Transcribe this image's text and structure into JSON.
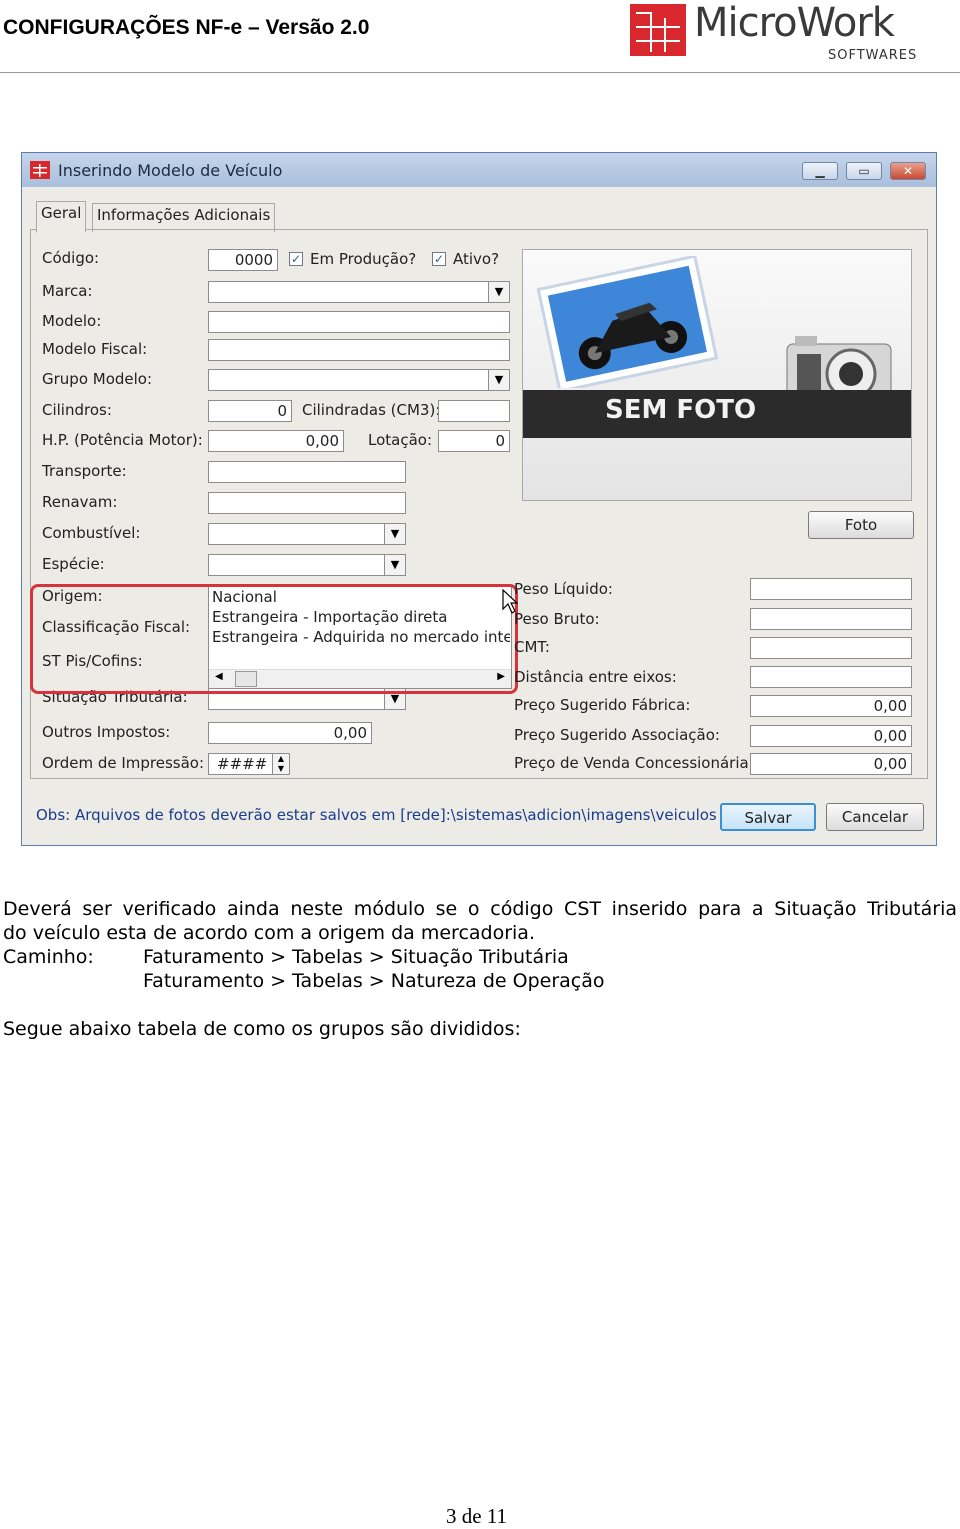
{
  "header": {
    "title": "CONFIGURAÇÕES NF-e – Versão 2.0",
    "logo_name": "MicroWork",
    "logo_sub": "SOFTWARES"
  },
  "window": {
    "title": "Inserindo Modelo de Veículo",
    "controls": {
      "minimize": "minimize-icon",
      "maximize": "maximize-icon",
      "close": "close-icon"
    },
    "tabs": [
      "Geral",
      "Informações Adicionais"
    ],
    "fields": {
      "codigo_label": "Código:",
      "codigo_value": "0000",
      "em_producao_label": "Em Produção?",
      "ativo_label": "Ativo?",
      "marca_label": "Marca:",
      "modelo_label": "Modelo:",
      "modelo_fiscal_label": "Modelo Fiscal:",
      "grupo_modelo_label": "Grupo Modelo:",
      "cilindros_label": "Cilindros:",
      "cilindros_value": "0",
      "cilindradas_label": "Cilindradas (CM3):",
      "hp_label": "H.P. (Potência Motor):",
      "hp_value": "0,00",
      "lotacao_label": "Lotação:",
      "lotacao_value": "0",
      "transporte_label": "Transporte:",
      "renavam_label": "Renavam:",
      "combustivel_label": "Combustível:",
      "especie_label": "Espécie:",
      "origem_label": "Origem:",
      "classificacao_label": "Classificação Fiscal:",
      "st_pis_label": "ST Pis/Cofins:",
      "situacao_label": "Situação Tributária:",
      "outros_label": "Outros Impostos:",
      "outros_value": "0,00",
      "ordem_label": "Ordem de Impressão:",
      "ordem_value": "####",
      "peso_liquido_label": "Peso Líquido:",
      "peso_bruto_label": "Peso Bruto:",
      "cmt_label": "CMT:",
      "distancia_label": "Distância entre eixos:",
      "preco_fabrica_label": "Preço Sugerido Fábrica:",
      "preco_fabrica_value": "0,00",
      "preco_assoc_label": "Preço Sugerido Associação:",
      "preco_assoc_value": "0,00",
      "preco_conc_label": "Preço de Venda Concessionária:",
      "preco_conc_value": "0,00"
    },
    "origem_options": [
      "Nacional",
      "Estrangeira - Importação direta",
      "Estrangeira - Adquirida no mercado intern"
    ],
    "photo_text": "SEM FOTO",
    "foto_button": "Foto",
    "obs": "Obs: Arquivos de fotos deverão estar salvos em [rede]:\\sistemas\\adicion\\imagens\\veiculos",
    "salvar": "Salvar",
    "cancelar": "Cancelar"
  },
  "body": {
    "para1_line1": "Deverá ser verificado ainda neste módulo se o código CST inserido para a Situação Tributária",
    "para1_line2": "do veículo esta de acordo com a origem da mercadoria.",
    "caminho_label": "Caminho:",
    "path1": "Faturamento > Tabelas > Situação Tributária",
    "path2": "Faturamento > Tabelas > Natureza de Operação",
    "para2": "Segue abaixo tabela de como os grupos são divididos:"
  },
  "footer": {
    "page": "3 de 11"
  },
  "colors": {
    "highlight": "#d8323c",
    "logo_red": "#d9272e",
    "obs_text": "#1a3c8c"
  }
}
